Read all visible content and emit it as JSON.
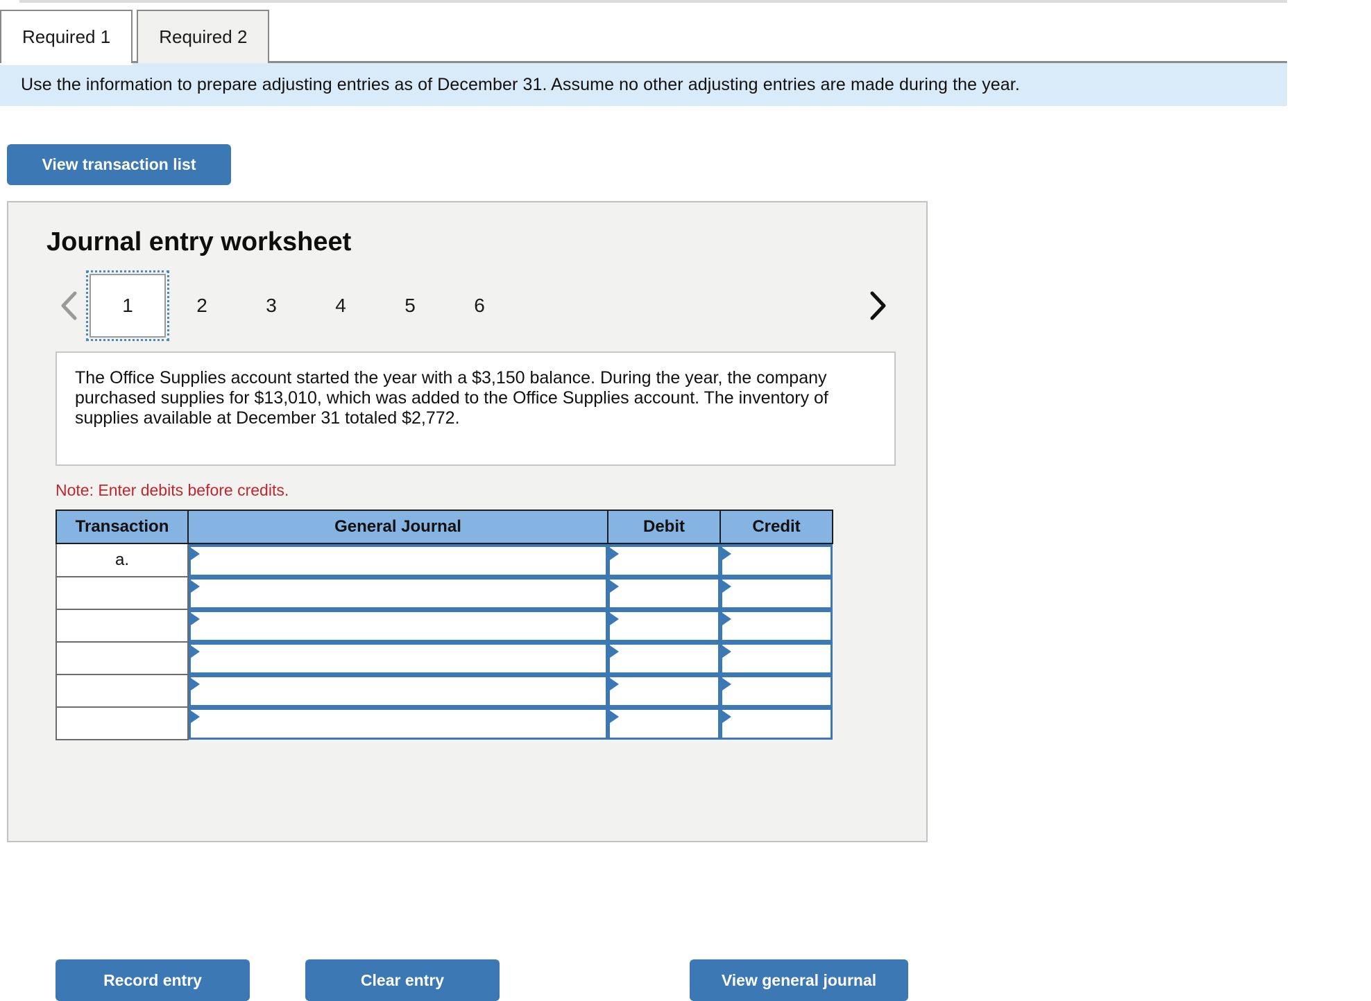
{
  "tabs": [
    {
      "label": "Required 1",
      "active": true
    },
    {
      "label": "Required 2",
      "active": false
    }
  ],
  "info_bar": {
    "text": "Use the information to prepare adjusting entries as of December 31. Assume no other adjusting entries are made during the year."
  },
  "buttons": {
    "view_transaction_list": "View transaction list",
    "record_entry": "Record entry",
    "clear_entry": "Clear entry",
    "view_general_journal": "View general journal"
  },
  "panel": {
    "title": "Journal entry worksheet",
    "pager": {
      "prev_icon": "chevron-left-icon",
      "next_icon": "chevron-right-icon",
      "prev_enabled": false,
      "next_enabled": true,
      "pages": [
        "1",
        "2",
        "3",
        "4",
        "5",
        "6"
      ],
      "selected": "1"
    },
    "description": "The Office Supplies account started the year with a $3,150 balance. During the year, the company purchased supplies for $13,010, which was added to the Office Supplies account. The inventory of supplies available at December 31 totaled $2,772.",
    "note": "Note: Enter debits before credits.",
    "table": {
      "headers": [
        "Transaction",
        "General Journal",
        "Debit",
        "Credit"
      ],
      "rows": [
        {
          "transaction": "a.",
          "general_journal": "",
          "debit": "",
          "credit": ""
        },
        {
          "transaction": "",
          "general_journal": "",
          "debit": "",
          "credit": ""
        },
        {
          "transaction": "",
          "general_journal": "",
          "debit": "",
          "credit": ""
        },
        {
          "transaction": "",
          "general_journal": "",
          "debit": "",
          "credit": ""
        },
        {
          "transaction": "",
          "general_journal": "",
          "debit": "",
          "credit": ""
        },
        {
          "transaction": "",
          "general_journal": "",
          "debit": "",
          "credit": ""
        }
      ]
    }
  },
  "colors": {
    "accent_blue": "#3c78b4",
    "info_bar_bg": "#d9eaf8",
    "table_header_bg": "#85b3e2",
    "note_red": "#c0262d",
    "panel_bg": "#f2f2f1"
  }
}
